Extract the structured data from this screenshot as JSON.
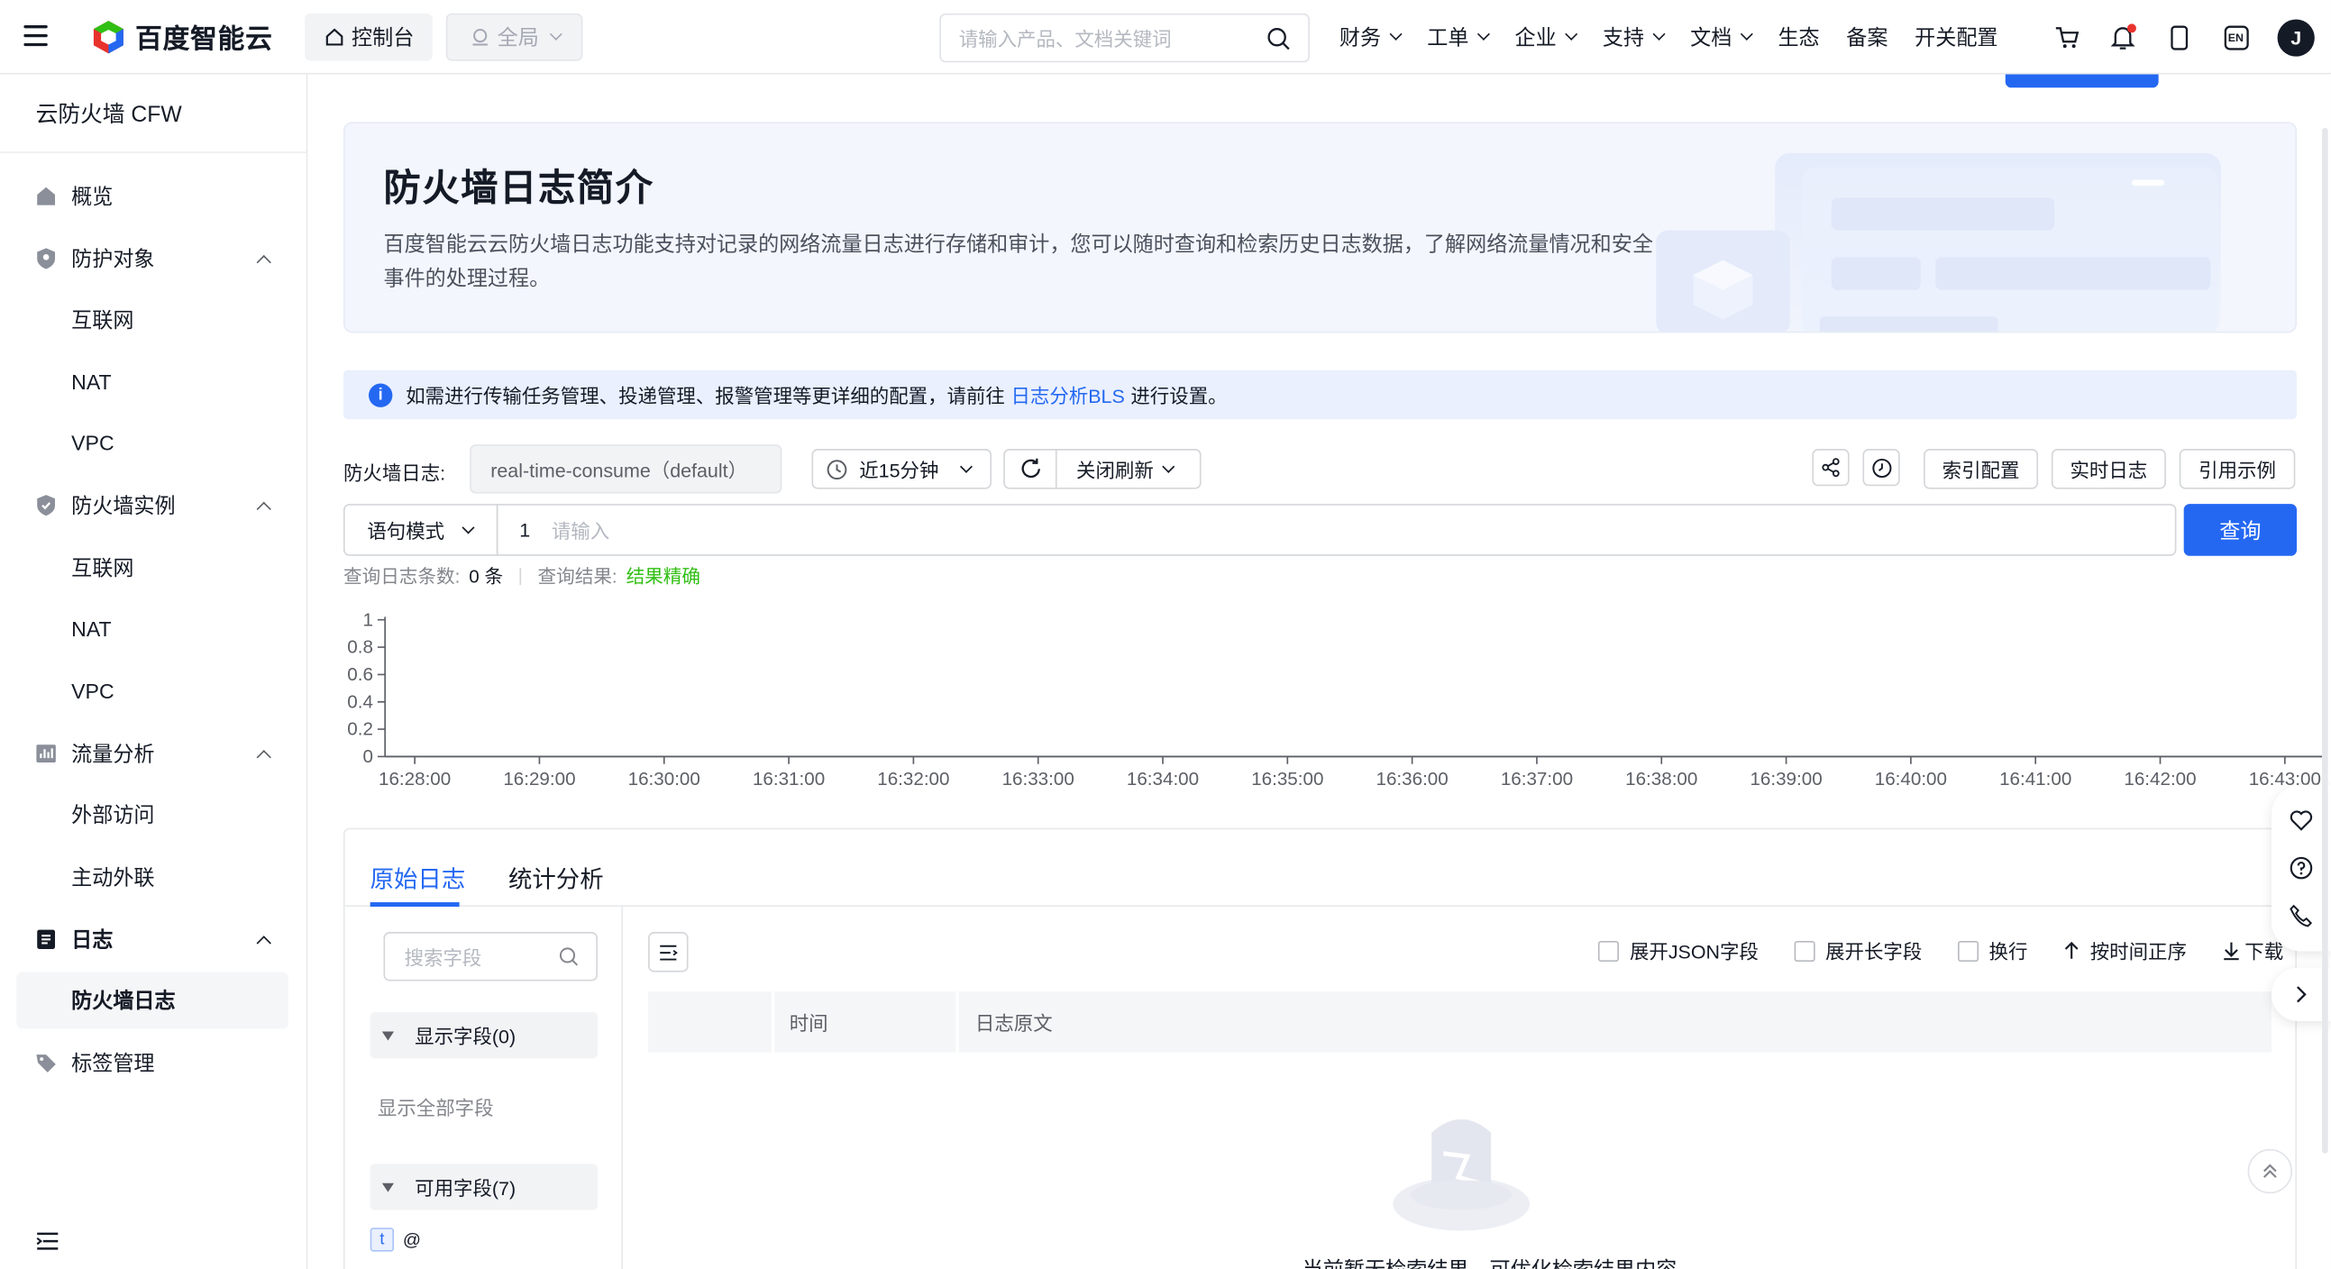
{
  "header": {
    "brand": "百度智能云",
    "console_label": "控制台",
    "region_label": "全局",
    "search_placeholder": "请输入产品、文档关键词",
    "nav": [
      {
        "label": "财务",
        "dropdown": true
      },
      {
        "label": "工单",
        "dropdown": true
      },
      {
        "label": "企业",
        "dropdown": true
      },
      {
        "label": "支持",
        "dropdown": true
      },
      {
        "label": "文档",
        "dropdown": true
      },
      {
        "label": "生态",
        "dropdown": false
      },
      {
        "label": "备案",
        "dropdown": false
      },
      {
        "label": "开关配置",
        "dropdown": false
      }
    ],
    "lang_label": "EN",
    "avatar_initial": "J"
  },
  "sidebar": {
    "title": "云防火墙 CFW",
    "items": [
      {
        "label": "概览",
        "icon": "home-icon"
      },
      {
        "label": "防护对象",
        "icon": "shield-icon",
        "expanded": true
      },
      {
        "label": "互联网"
      },
      {
        "label": "NAT"
      },
      {
        "label": "VPC"
      },
      {
        "label": "防火墙实例",
        "icon": "shield-check-icon",
        "expanded": true
      },
      {
        "label": "互联网"
      },
      {
        "label": "NAT"
      },
      {
        "label": "VPC"
      },
      {
        "label": "流量分析",
        "icon": "chart-icon",
        "expanded": true
      },
      {
        "label": "外部访问"
      },
      {
        "label": "主动外联"
      },
      {
        "label": "日志",
        "icon": "log-icon",
        "expanded": true
      },
      {
        "label": "防火墙日志",
        "active": true
      },
      {
        "label": "标签管理",
        "icon": "tag-icon"
      }
    ]
  },
  "intro": {
    "title": "防火墙日志简介",
    "description": "百度智能云云防火墙日志功能支持对记录的网络流量日志进行存储和审计，您可以随时查询和检索历史日志数据，了解网络流量情况和安全事件的处理过程。"
  },
  "notice": {
    "text_before": "如需进行传输任务管理、投递管理、报警管理等更详细的配置，请前往",
    "link": "日志分析BLS",
    "text_after": "进行设置。"
  },
  "controls": {
    "logstore_label": "防火墙日志:",
    "logstore_value": "real-time-consume（default）",
    "time_range": "近15分钟",
    "refresh_label": "关闭刷新",
    "buttons": [
      "索引配置",
      "实时日志",
      "引用示例"
    ]
  },
  "query": {
    "mode": "语句模式",
    "line_no": "1",
    "placeholder": "请输入",
    "submit": "查询"
  },
  "stats": {
    "count_label": "查询日志条数:",
    "count_value": "0 条",
    "result_label": "查询结果:",
    "result_value": "结果精确"
  },
  "chart_data": {
    "type": "line",
    "x": [
      "16:28:00",
      "16:29:00",
      "16:30:00",
      "16:31:00",
      "16:32:00",
      "16:33:00",
      "16:34:00",
      "16:35:00",
      "16:36:00",
      "16:37:00",
      "16:38:00",
      "16:39:00",
      "16:40:00",
      "16:41:00",
      "16:42:00",
      "16:43:00"
    ],
    "y_ticks": [
      "0",
      "0.2",
      "0.4",
      "0.6",
      "0.8",
      "1"
    ],
    "values": [
      0,
      0,
      0,
      0,
      0,
      0,
      0,
      0,
      0,
      0,
      0,
      0,
      0,
      0,
      0,
      0
    ],
    "ylim": [
      0,
      1
    ],
    "xlabel": "",
    "ylabel": ""
  },
  "tabs": [
    "原始日志",
    "统计分析"
  ],
  "fields": {
    "search_placeholder": "搜索字段",
    "shown_group": "显示字段(0)",
    "show_all": "显示全部字段",
    "available_group": "可用字段(7)",
    "first_field_type": "t",
    "first_field_name": "@"
  },
  "log_options": [
    "展开JSON字段",
    "展开长字段",
    "换行",
    "按时间正序",
    "下载"
  ],
  "log_table": {
    "columns": [
      "时间",
      "日志原文"
    ],
    "empty_text": "当前暂无检索结果，可优化检索结果内容"
  },
  "colors": {
    "accent": "#2468f2",
    "success": "#30bf13",
    "text": "#151b26"
  }
}
